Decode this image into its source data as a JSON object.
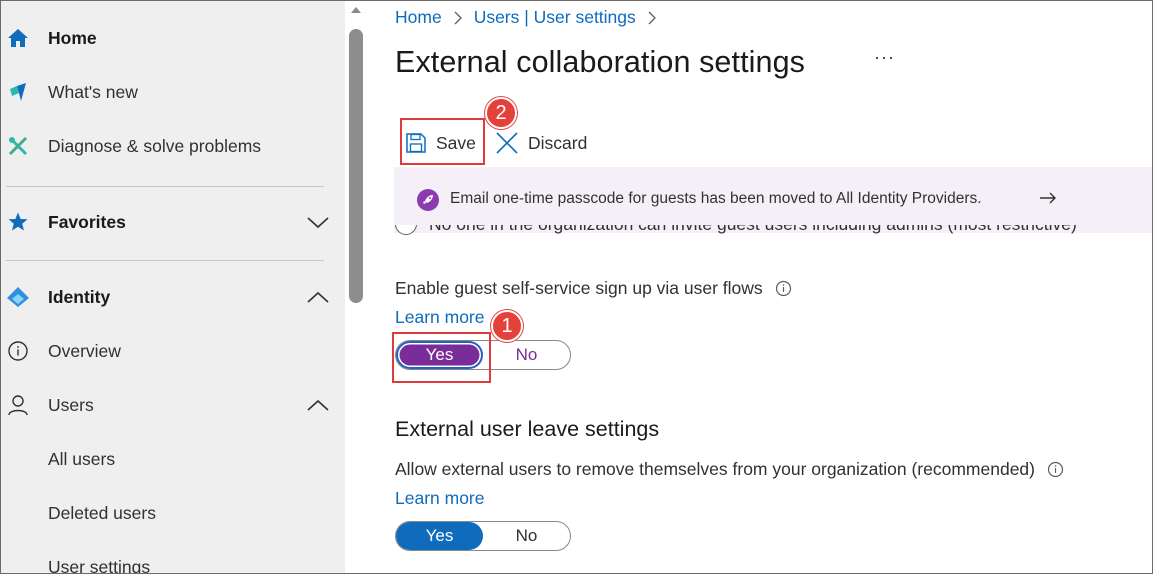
{
  "sidebar": {
    "items": [
      {
        "label": "Home",
        "icon": "home-icon"
      },
      {
        "label": "What's new",
        "icon": "whats-new-icon"
      },
      {
        "label": "Diagnose & solve problems",
        "icon": "wrench-icon"
      },
      {
        "label": "Favorites",
        "icon": "star-icon"
      },
      {
        "label": "Identity",
        "icon": "identity-diamond-icon"
      },
      {
        "label": "Overview",
        "icon": "info-icon"
      },
      {
        "label": "Users",
        "icon": "person-icon"
      },
      {
        "label": "All users"
      },
      {
        "label": "Deleted users"
      },
      {
        "label": "User settings"
      }
    ]
  },
  "breadcrumb": {
    "home": "Home",
    "users": "Users | User settings"
  },
  "page": {
    "title": "External collaboration settings",
    "more": "···"
  },
  "toolbar": {
    "save_label": "Save",
    "discard_label": "Discard"
  },
  "annotations": {
    "badge1": "1",
    "badge2": "2"
  },
  "banner": {
    "text": "Email one-time passcode for guests has been moved to All Identity Providers."
  },
  "guest_invite": {
    "clipped_option": "No one in the organization can invite guest users including admins (most restrictive)"
  },
  "self_service": {
    "label": "Enable guest self-service sign up via user flows",
    "learn_more": "Learn more",
    "yes": "Yes",
    "no": "No",
    "selected": "Yes"
  },
  "leave_settings": {
    "heading": "External user leave settings",
    "label": "Allow external users to remove themselves from your organization (recommended)",
    "learn_more": "Learn more",
    "yes": "Yes",
    "no": "No",
    "selected": "Yes"
  },
  "colors": {
    "link": "#0f6cbd",
    "toggle_purple": "#7a2d98",
    "toggle_blue": "#0f6cbd",
    "annotation_red": "#e5413b",
    "banner_bg": "#f5f0f7",
    "sidebar_bg": "#efefef"
  }
}
